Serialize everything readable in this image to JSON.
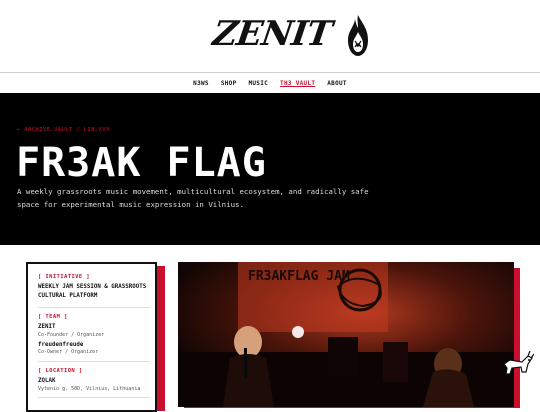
{
  "brand": {
    "logo_text": "ZENIT"
  },
  "nav": {
    "items": [
      {
        "label": "N3WS"
      },
      {
        "label": "SHOP"
      },
      {
        "label": "MUSIC"
      },
      {
        "label": "TH3 VAULT",
        "active": true
      },
      {
        "label": "ABOUT"
      }
    ]
  },
  "hero": {
    "breadcrumb": "← ARCHIVE.VAULT / LIB.XXX",
    "title": "FR3AK FLAG",
    "description": "A weekly grassroots music movement, multicultural ecosystem, and radically safe space for experimental music expression in Vilnius."
  },
  "info": {
    "initiative": {
      "label": "[ INITIATIVE ]",
      "value": "WEEKLY JAM SESSION & GRASSROOTS CULTURAL PLATFORM"
    },
    "team": {
      "label": "[ TEAM ]",
      "members": [
        {
          "name": "ZENIT",
          "role": "Co-Founder / Organizer"
        },
        {
          "name": "freudenfreude",
          "role": "Co-Owner / Organizer"
        }
      ]
    },
    "location": {
      "label": "[ LOCATION ]",
      "name": "ZOLAK",
      "address": "Vytenio g. 50D, Vilnius, Lithuania"
    }
  },
  "photo": {
    "banner_text": "FR3AKFLAG JAM"
  },
  "colors": {
    "accent": "#c8102e",
    "hero_bg": "#000000",
    "text": "#111111"
  }
}
